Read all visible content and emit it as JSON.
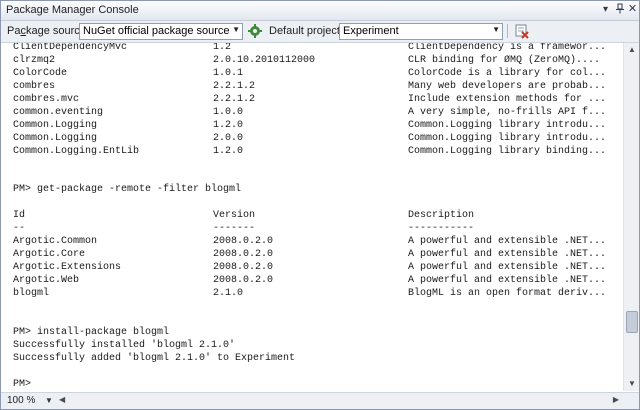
{
  "window": {
    "title": "Package Manager Console"
  },
  "toolbar": {
    "source_label_prefix": "Pa",
    "source_label_hotkey": "c",
    "source_label_suffix": "kage source:",
    "source_value": "NuGet official package source",
    "default_project_label": "Default project:",
    "default_project_value": "Experiment"
  },
  "console": {
    "top_packages": [
      {
        "id": "ClientDependencyMvc",
        "version": "1.2",
        "description": "ClientDependency is a framewor..."
      },
      {
        "id": "clrzmq2",
        "version": "2.0.10.2010112000",
        "description": "CLR binding for ØMQ (ZeroMQ)...."
      },
      {
        "id": "ColorCode",
        "version": "1.0.1",
        "description": "ColorCode is a library for col..."
      },
      {
        "id": "combres",
        "version": "2.2.1.2",
        "description": "Many web developers are probab..."
      },
      {
        "id": "combres.mvc",
        "version": "2.2.1.2",
        "description": "Include extension methods for ..."
      },
      {
        "id": "common.eventing",
        "version": "1.0.0",
        "description": "A very simple, no-frills API f..."
      },
      {
        "id": "Common.Logging",
        "version": "1.2.0",
        "description": "Common.Logging library introdu..."
      },
      {
        "id": "Common.Logging",
        "version": "2.0.0",
        "description": "Common.Logging library introdu..."
      },
      {
        "id": "Common.Logging.EntLib",
        "version": "1.2.0",
        "description": "Common.Logging library binding..."
      }
    ],
    "command1": "PM> get-package -remote -filter blogml",
    "headers": {
      "id": "Id",
      "version": "Version",
      "description": "Description"
    },
    "dashes": {
      "id": "--",
      "version": "-------",
      "description": "-----------"
    },
    "result_packages": [
      {
        "id": "Argotic.Common",
        "version": "2008.0.2.0",
        "description": "A powerful and extensible .NET..."
      },
      {
        "id": "Argotic.Core",
        "version": "2008.0.2.0",
        "description": "A powerful and extensible .NET..."
      },
      {
        "id": "Argotic.Extensions",
        "version": "2008.0.2.0",
        "description": "A powerful and extensible .NET..."
      },
      {
        "id": "Argotic.Web",
        "version": "2008.0.2.0",
        "description": "A powerful and extensible .NET..."
      },
      {
        "id": "blogml",
        "version": "2.1.0",
        "description": "BlogML is an open format deriv..."
      }
    ],
    "command2": "PM> install-package blogml",
    "output1": "Successfully installed 'blogml 2.1.0'",
    "output2": "Successfully added 'blogml 2.1.0' to Experiment",
    "prompt": "PM>"
  },
  "status": {
    "zoom": "100 %"
  },
  "colors": {
    "accent": "#3e8a3a",
    "clear_red": "#c0392b",
    "chrome": "#eceff4"
  }
}
